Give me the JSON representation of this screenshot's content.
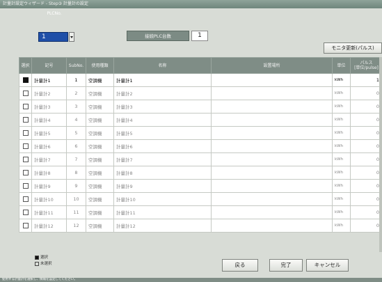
{
  "window": {
    "title": "計量計設定ウィザード - Step③ 計量計の設定"
  },
  "plc": {
    "label": "PLCNo.",
    "value": "1"
  },
  "plc_count": {
    "label": "接続PLC台数",
    "value": "1"
  },
  "monitor_button": "モニタ更新(パルス)",
  "table": {
    "headers": {
      "select": "選択",
      "code": "記号",
      "subno": "SubNo.",
      "type": "使用種類",
      "name": "名称",
      "location": "設置場所",
      "unit": "単位",
      "pulse": "パルス\n[単位/pulse]"
    },
    "rows": [
      {
        "selected": true,
        "code": "計量計1",
        "subno": "1",
        "type": "空調機",
        "name": "計量計1",
        "location": "",
        "unit": "kWh",
        "pulse": "1"
      },
      {
        "selected": false,
        "code": "計量計2",
        "subno": "2",
        "type": "空調機",
        "name": "計量計2",
        "location": "",
        "unit": "kWh",
        "pulse": "0"
      },
      {
        "selected": false,
        "code": "計量計3",
        "subno": "3",
        "type": "空調機",
        "name": "計量計3",
        "location": "",
        "unit": "kWh",
        "pulse": "0"
      },
      {
        "selected": false,
        "code": "計量計4",
        "subno": "4",
        "type": "空調機",
        "name": "計量計4",
        "location": "",
        "unit": "kWh",
        "pulse": "0"
      },
      {
        "selected": false,
        "code": "計量計5",
        "subno": "5",
        "type": "空調機",
        "name": "計量計5",
        "location": "",
        "unit": "kWh",
        "pulse": "0"
      },
      {
        "selected": false,
        "code": "計量計6",
        "subno": "6",
        "type": "空調機",
        "name": "計量計6",
        "location": "",
        "unit": "kWh",
        "pulse": "0"
      },
      {
        "selected": false,
        "code": "計量計7",
        "subno": "7",
        "type": "空調機",
        "name": "計量計7",
        "location": "",
        "unit": "kWh",
        "pulse": "0"
      },
      {
        "selected": false,
        "code": "計量計8",
        "subno": "8",
        "type": "空調機",
        "name": "計量計8",
        "location": "",
        "unit": "kWh",
        "pulse": "0"
      },
      {
        "selected": false,
        "code": "計量計9",
        "subno": "9",
        "type": "空調機",
        "name": "計量計9",
        "location": "",
        "unit": "kWh",
        "pulse": "0"
      },
      {
        "selected": false,
        "code": "計量計10",
        "subno": "10",
        "type": "空調機",
        "name": "計量計10",
        "location": "",
        "unit": "kWh",
        "pulse": "0"
      },
      {
        "selected": false,
        "code": "計量計11",
        "subno": "11",
        "type": "空調機",
        "name": "計量計11",
        "location": "",
        "unit": "kWh",
        "pulse": "0"
      },
      {
        "selected": false,
        "code": "計量計12",
        "subno": "12",
        "type": "空調機",
        "name": "計量計12",
        "location": "",
        "unit": "kWh",
        "pulse": "0"
      }
    ]
  },
  "legend": {
    "selected": "選択",
    "unselected": "未選択"
  },
  "buttons": {
    "back": "戻る",
    "done": "完了",
    "cancel": "キャンセル"
  },
  "status": "使用する計量計を選択し、情報を設定してください。"
}
